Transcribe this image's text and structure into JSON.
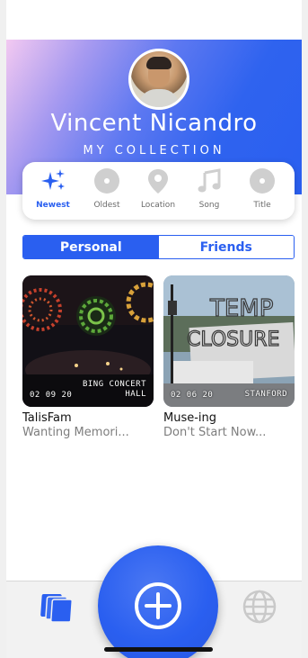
{
  "profile": {
    "name": "Vincent Nicandro",
    "subtitle": "MY COLLECTION"
  },
  "filters": [
    {
      "label": "Newest",
      "icon": "sparkles-icon",
      "active": true
    },
    {
      "label": "Oldest",
      "icon": "disc-icon",
      "active": false
    },
    {
      "label": "Location",
      "icon": "map-pin-icon",
      "active": false
    },
    {
      "label": "Song",
      "icon": "music-note-icon",
      "active": false
    },
    {
      "label": "Title",
      "icon": "disc-icon",
      "active": false
    }
  ],
  "tabs": {
    "personal": "Personal",
    "friends": "Friends"
  },
  "cards": [
    {
      "date": "02 09 20",
      "location_line1": "BING CONCERT",
      "location_line2": "HALL",
      "title": "TalisFam",
      "subtitle": "Wanting Memori..."
    },
    {
      "date": "02 06 20",
      "location_line1": "STANFORD",
      "location_line2": "",
      "title": "Muse-ing",
      "subtitle": "Don't Start Now..."
    }
  ],
  "bottom_nav": {
    "left_icon": "collection-icon",
    "center_icon": "plus-icon",
    "right_icon": "globe-icon"
  },
  "colors": {
    "accent": "#2a5ff0",
    "inactive": "#c9c9c9"
  }
}
